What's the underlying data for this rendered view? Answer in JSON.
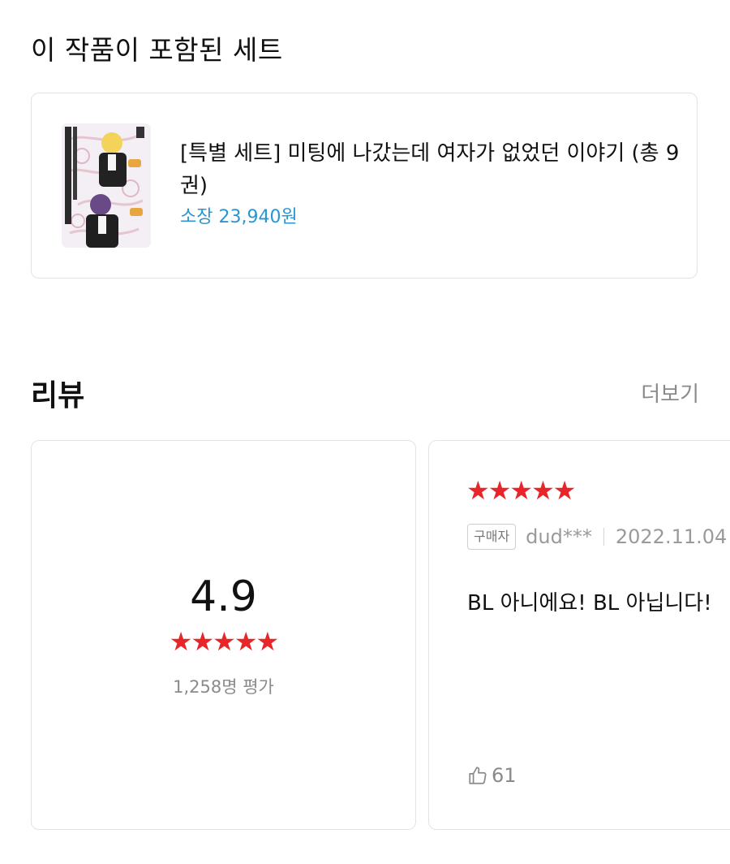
{
  "set_section": {
    "title": "이 작품이 포함된 세트",
    "item": {
      "title": "[특별 세트] 미팅에 나갔는데 여자가 없었던 이야기 (총 9권)",
      "price": "소장 23,940원"
    }
  },
  "review_section": {
    "title": "리뷰",
    "more_label": "더보기",
    "summary": {
      "score": "4.9",
      "stars": 5,
      "count_label": "1,258명 평가"
    },
    "review": {
      "stars": 5,
      "badge": "구매자",
      "user": "dud***",
      "date": "2022.11.04",
      "text": "BL 아니에요! BL 아닙니다!",
      "likes": "61"
    }
  },
  "colors": {
    "star": "#e8262a",
    "price": "#2a95d3",
    "muted": "#8a8a8a",
    "border": "#e3e3e3"
  },
  "icons": {
    "star": "star-icon",
    "like": "thumbs-up-icon"
  }
}
